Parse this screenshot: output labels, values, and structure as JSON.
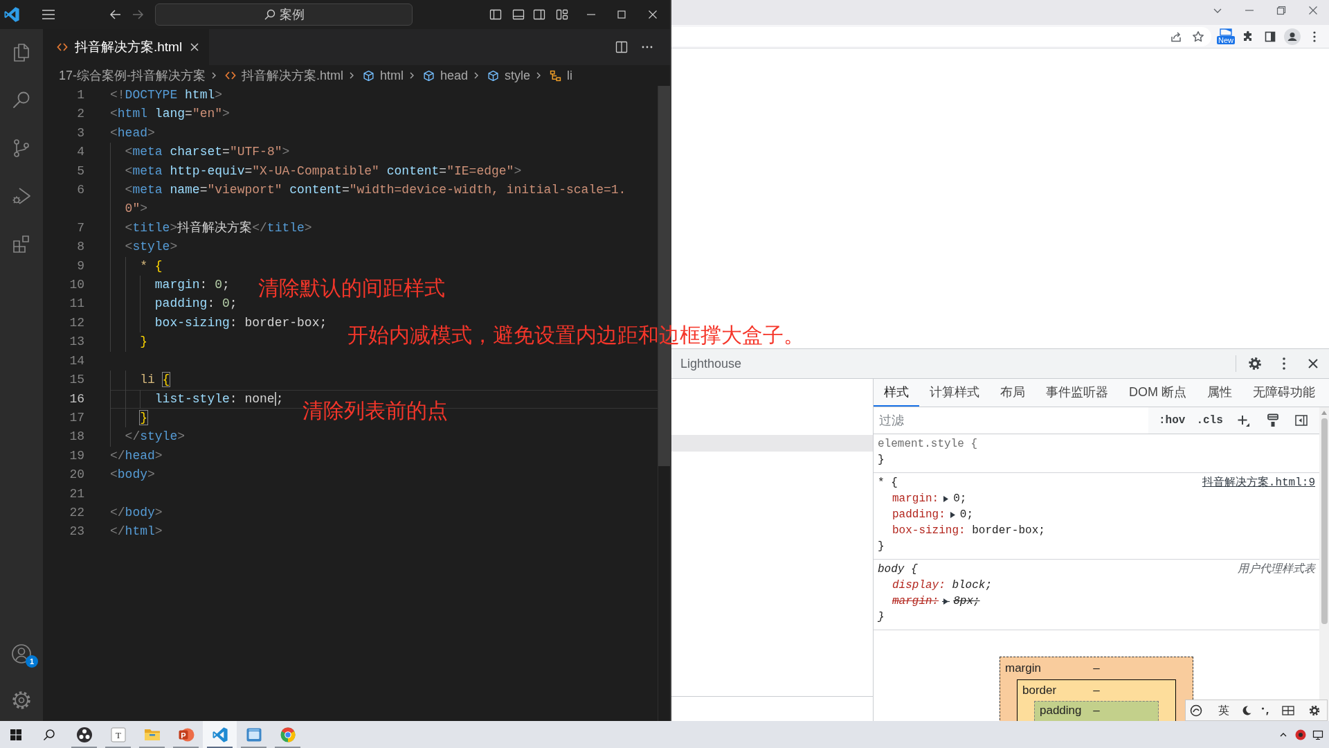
{
  "vscode": {
    "command_center": "案例",
    "account_badge": "1",
    "tabs": [
      {
        "label": "抖音解决方案.html",
        "selected": true
      }
    ],
    "breadcrumbs": [
      {
        "kind": "folder",
        "label": "17-综合案例-抖音解决方案"
      },
      {
        "kind": "file",
        "label": "抖音解决方案.html"
      },
      {
        "kind": "element",
        "label": "html"
      },
      {
        "kind": "element",
        "label": "head"
      },
      {
        "kind": "element",
        "label": "style"
      },
      {
        "kind": "symbol",
        "label": "li"
      }
    ],
    "editor": {
      "lines": [
        {
          "number": "1",
          "kind": "html",
          "current": false,
          "text": "<!DOCTYPE html>"
        },
        {
          "number": "2",
          "kind": "html",
          "current": false,
          "text": "<html lang=\"en\">"
        },
        {
          "number": "3",
          "kind": "html",
          "current": false,
          "text": "<head>"
        },
        {
          "number": "4",
          "kind": "html",
          "current": false,
          "text": "  <meta charset=\"UTF-8\">"
        },
        {
          "number": "5",
          "kind": "html",
          "current": false,
          "text": "  <meta http-equiv=\"X-UA-Compatible\" content=\"IE=edge\">"
        },
        {
          "number": "6",
          "kind": "html",
          "current": false,
          "text": "  <meta name=\"viewport\" content=\"width=device-width, initial-scale=1.0\">"
        },
        {
          "number": "7",
          "kind": "html",
          "current": false,
          "text": "  <title>抖音解决方案</title>"
        },
        {
          "number": "8",
          "kind": "html",
          "current": false,
          "text": "  <style>"
        },
        {
          "number": "9",
          "kind": "css",
          "current": false,
          "text": "    * {"
        },
        {
          "number": "10",
          "kind": "css",
          "current": false,
          "text": "      margin: 0;"
        },
        {
          "number": "11",
          "kind": "css",
          "current": false,
          "text": "      padding: 0;"
        },
        {
          "number": "12",
          "kind": "css",
          "current": false,
          "text": "      box-sizing: border-box;"
        },
        {
          "number": "13",
          "kind": "css",
          "current": false,
          "text": "    }"
        },
        {
          "number": "14",
          "current": false
        },
        {
          "number": "15",
          "kind": "css",
          "current": false,
          "text": "    li {"
        },
        {
          "number": "16",
          "kind": "css",
          "current": true,
          "text": "      list-style: none",
          "text_after_cursor": ";"
        },
        {
          "number": "17",
          "kind": "css",
          "current": false,
          "text": "    }"
        },
        {
          "number": "18",
          "kind": "html",
          "current": false,
          "text": "  </style>"
        },
        {
          "number": "19",
          "kind": "html",
          "current": false,
          "text": "</head>"
        },
        {
          "number": "20",
          "kind": "html",
          "current": false,
          "text": "<body>"
        },
        {
          "number": "21",
          "current": false
        },
        {
          "number": "22",
          "kind": "html",
          "current": false,
          "text": "</body>"
        },
        {
          "number": "23",
          "kind": "html",
          "current": false,
          "text": "</html>"
        }
      ]
    }
  },
  "annotations": [
    {
      "text": "清除默认的间距样式"
    },
    {
      "text": "开始内减模式，避免设置内边距和边框撑大盒子。"
    },
    {
      "text": "清除列表前的点"
    }
  ],
  "browser": {
    "extension_badge": "New",
    "devtools": {
      "panel_tab": "Lighthouse",
      "sidebar_tabs": [
        {
          "label": "样式",
          "selected": true
        },
        {
          "label": "计算样式",
          "selected": false
        },
        {
          "label": "布局",
          "selected": false
        },
        {
          "label": "事件监听器",
          "selected": false
        },
        {
          "label": "DOM 断点",
          "selected": false
        },
        {
          "label": "属性",
          "selected": false
        },
        {
          "label": "无障碍功能",
          "selected": false
        }
      ],
      "filter": {
        "placeholder": "过滤"
      },
      "toggles": [
        ":hov",
        ".cls"
      ],
      "rules": [
        {
          "kind": "inline",
          "selector": "element.style {",
          "close": "}"
        },
        {
          "kind": "author",
          "selector": "* {",
          "source": "抖音解决方案.html:9",
          "declarations": [
            {
              "name": "margin:",
              "value": "0;",
              "expandable": true,
              "overridden": false
            },
            {
              "name": "padding:",
              "value": "0;",
              "expandable": true,
              "overridden": false
            },
            {
              "name": "box-sizing:",
              "value": "border-box;",
              "expandable": false,
              "overridden": false
            }
          ],
          "close": "}"
        },
        {
          "kind": "user-agent",
          "selector": "body {",
          "source": "用户代理样式表",
          "declarations": [
            {
              "name": "display:",
              "value": "block;",
              "expandable": false,
              "overridden": false
            },
            {
              "name": "margin:",
              "value": "8px;",
              "expandable": true,
              "overridden": true
            }
          ],
          "close": "}"
        }
      ],
      "box_model": [
        {
          "label": "margin",
          "value": "–"
        },
        {
          "label": "border",
          "value": "–"
        },
        {
          "label": "padding",
          "value": "–"
        }
      ]
    }
  },
  "ime_toolbar": {
    "mode": "英"
  },
  "taskbar": {
    "apps": [
      {
        "kind": "recorder",
        "running": true,
        "selected": false
      },
      {
        "kind": "text-editor",
        "label": "T",
        "running": true,
        "selected": false
      },
      {
        "kind": "file-explorer",
        "running": true,
        "selected": false
      },
      {
        "kind": "presentation",
        "label": "P",
        "running": true,
        "selected": false
      },
      {
        "kind": "code-editor",
        "running": true,
        "selected": true
      },
      {
        "kind": "app",
        "running": true,
        "selected": false
      },
      {
        "kind": "browser",
        "running": true,
        "selected": false
      }
    ]
  }
}
